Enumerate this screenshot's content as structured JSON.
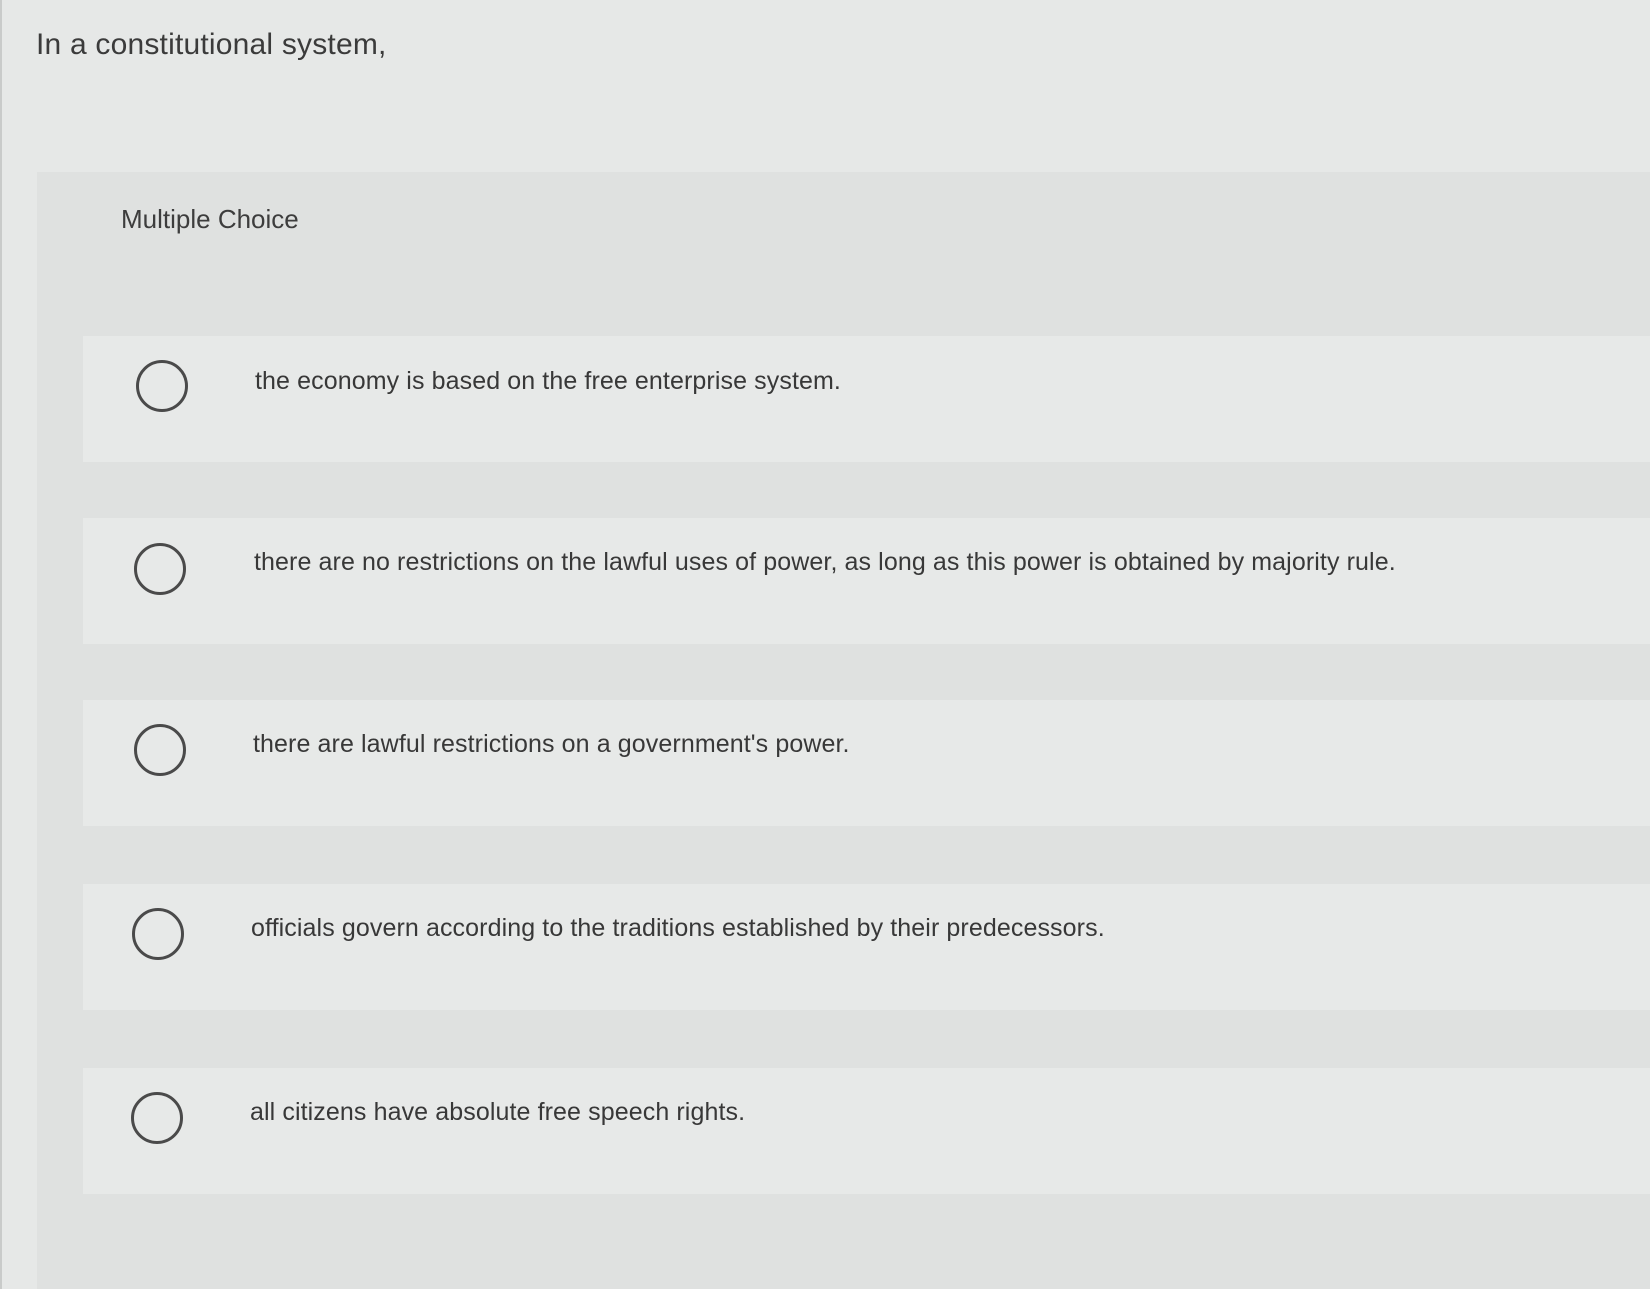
{
  "question": {
    "text": "In a constitutional system,"
  },
  "question_type": "Multiple Choice",
  "options": [
    {
      "label": "the economy is based on the free enterprise system.",
      "selected": false
    },
    {
      "label": "there are no restrictions on the lawful uses of power, as long as this power is obtained by majority rule.",
      "selected": false
    },
    {
      "label": "there are lawful restrictions on a government's power.",
      "selected": false
    },
    {
      "label": "officials govern according to the traditions established by their predecessors.",
      "selected": false
    },
    {
      "label": "all citizens have absolute free speech rights.",
      "selected": false
    }
  ],
  "colors": {
    "page_background": "#e6e8e7",
    "panel_background": "#dfe1e0",
    "option_background": "#e7e9e8",
    "text": "#383838",
    "radio_border": "#4a4a4a"
  }
}
